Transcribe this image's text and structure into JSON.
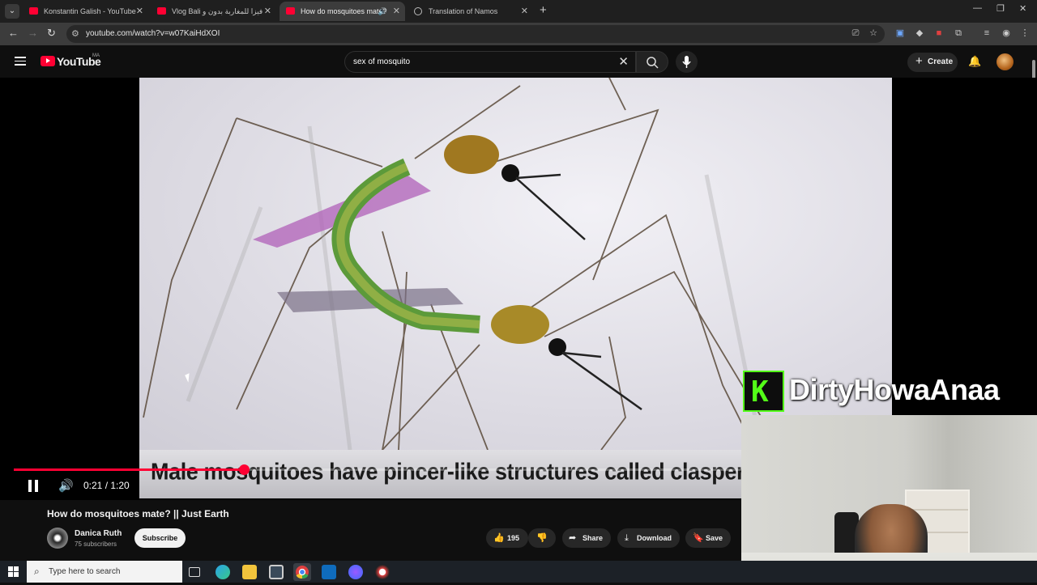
{
  "browser": {
    "tabs": [
      {
        "label": "Konstantin Galish - YouTube",
        "active": false
      },
      {
        "label": "Vlog Bali فيزا للمغاربة بدون و",
        "active": false
      },
      {
        "label": "How do mosquitoes mate?",
        "active": true
      },
      {
        "label": "Translation of Namos",
        "active": false
      }
    ],
    "url": "youtube.com/watch?v=w07KaiHdXOI"
  },
  "youtube": {
    "logo_text": "YouTube",
    "country_code": "MA",
    "search_query": "sex of mosquito",
    "create_label": "Create"
  },
  "player": {
    "subtitle": "Male mosquitoes have pincer-like structures called claspers on th",
    "current_time": "0:21 / 1:20",
    "progress_fraction": 0.2625
  },
  "video": {
    "title": "How do mosquitoes mate? || Just Earth",
    "channel_name": "Danica Ruth",
    "subscribers": "75 subscribers",
    "subscribe_label": "Subscribe",
    "likes": "195",
    "share_label": "Share",
    "download_label": "Download",
    "save_label": "Save"
  },
  "overlay": {
    "kick_letter": "K",
    "streamer_name": "DirtyHowaAnaa"
  },
  "taskbar": {
    "search_placeholder": "Type here to search"
  },
  "colors": {
    "accent": "#ff0033",
    "kick_green": "#53fc18"
  }
}
